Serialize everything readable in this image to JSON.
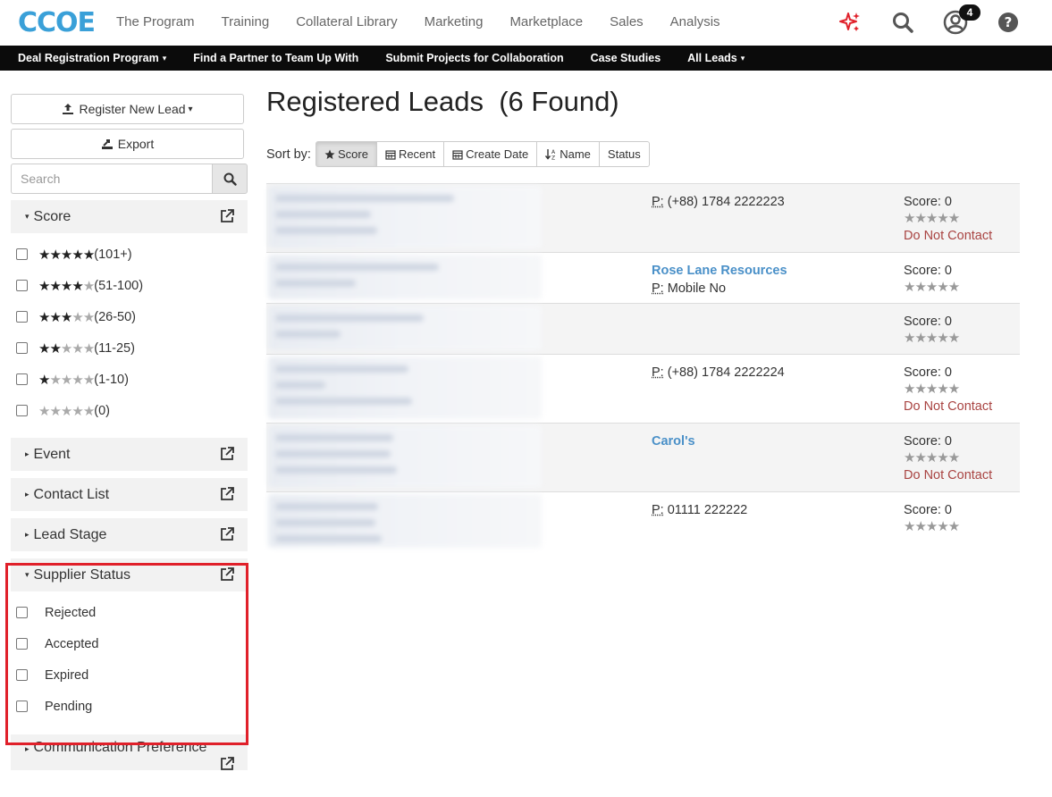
{
  "app": {
    "logo_text": "CCOE",
    "nav": [
      "The Program",
      "Training",
      "Collateral Library",
      "Marketing",
      "Marketplace",
      "Sales",
      "Analysis"
    ],
    "notification_count": "4",
    "icons": [
      "sparkle-icon",
      "search-icon",
      "user-icon",
      "help-icon"
    ],
    "accent_color": "#e0202a"
  },
  "subnav": {
    "items": [
      {
        "label": "Deal Registration Program",
        "caret": true
      },
      {
        "label": "Find a Partner to Team Up With",
        "caret": false
      },
      {
        "label": "Submit Projects for Collaboration",
        "caret": false
      },
      {
        "label": "Case Studies",
        "caret": false
      },
      {
        "label": "All Leads",
        "caret": true
      }
    ],
    "caret_glyph": "▾"
  },
  "sidebar": {
    "register_label": "Register New Lead",
    "register_caret": "▾",
    "export_label": "Export",
    "search_placeholder": "Search",
    "score": {
      "title": "Score",
      "items": [
        {
          "filled": 5,
          "range": "(101+)"
        },
        {
          "filled": 4,
          "range": "(51-100)"
        },
        {
          "filled": 3,
          "range": "(26-50)"
        },
        {
          "filled": 2,
          "range": "(11-25)"
        },
        {
          "filled": 1,
          "range": "(1-10)"
        },
        {
          "filled": 0,
          "range": "(0)"
        }
      ]
    },
    "collapsed_facets": [
      "Event",
      "Contact List",
      "Lead Stage"
    ],
    "supplier_status": {
      "title": "Supplier Status",
      "items": [
        "Rejected",
        "Accepted",
        "Expired",
        "Pending"
      ]
    },
    "communication_preference": "Communication Preference",
    "collapsed_glyph": "▸",
    "expanded_glyph": "▾"
  },
  "main": {
    "title": "Registered Leads",
    "count_text": "(6 Found)",
    "sort_label": "Sort by:",
    "sort_options": [
      "Score",
      "Recent",
      "Create Date",
      "Name",
      "Status"
    ],
    "active_sort": "Score",
    "leads": [
      {
        "phone": "(+88) 1784 2222223",
        "company": "",
        "mobile": "",
        "score": "Score: 0",
        "dnc": "Do Not Contact"
      },
      {
        "phone": "",
        "company": "Rose Lane Resources",
        "mobile": "Mobile No",
        "score": "Score: 0",
        "dnc": ""
      },
      {
        "phone": "",
        "company": "",
        "mobile": "",
        "score": "Score: 0",
        "dnc": ""
      },
      {
        "phone": "(+88) 1784 2222224",
        "company": "",
        "mobile": "",
        "score": "Score: 0",
        "dnc": "Do Not Contact"
      },
      {
        "phone": "",
        "company": "Carol's",
        "mobile": "",
        "score": "Score: 0",
        "dnc": "Do Not Contact"
      },
      {
        "phone": "01111 222222",
        "company": "",
        "mobile": "",
        "score": "Score: 0",
        "dnc": ""
      }
    ],
    "phone_prefix": "P:",
    "score_stars": "★★★★★"
  }
}
